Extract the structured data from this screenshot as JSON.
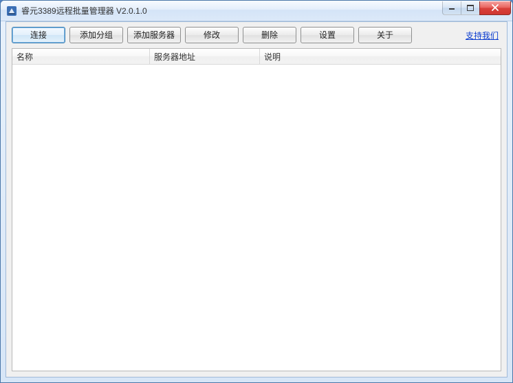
{
  "window": {
    "title": "睿元3389远程批量管理器 V2.0.1.0"
  },
  "toolbar": {
    "connect_label": "连接",
    "add_group_label": "添加分组",
    "add_server_label": "添加服务器",
    "modify_label": "修改",
    "delete_label": "删除",
    "settings_label": "设置",
    "about_label": "关于",
    "support_link_label": "支持我们"
  },
  "listview": {
    "columns": {
      "name": "名称",
      "address": "服务器地址",
      "description": "说明"
    },
    "rows": []
  }
}
